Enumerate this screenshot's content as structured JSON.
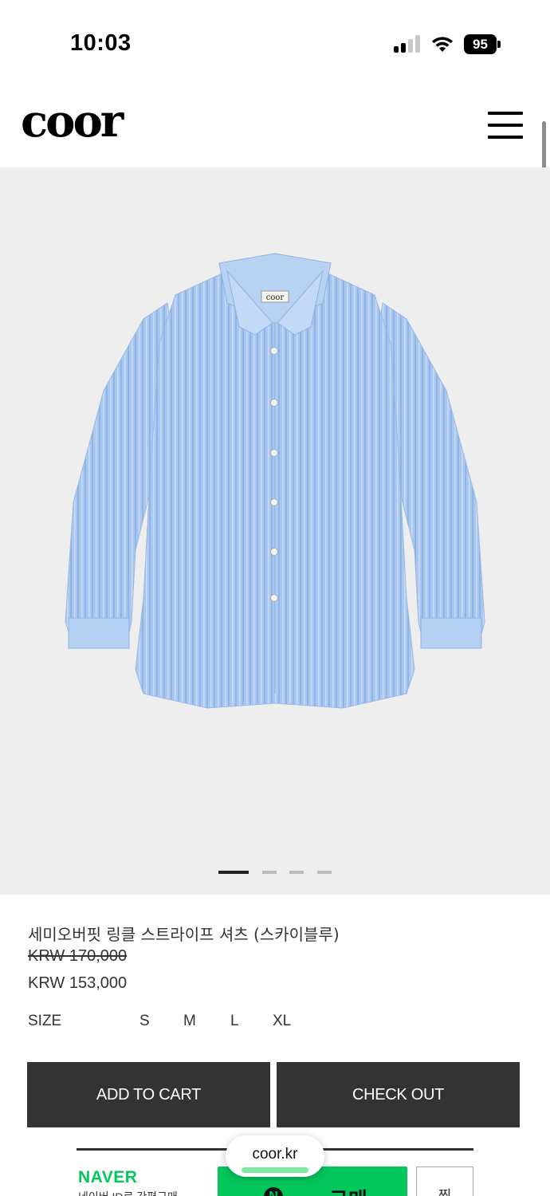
{
  "status_bar": {
    "time": "10:03",
    "battery": "95",
    "icons": [
      "signal-icon",
      "wifi-icon",
      "battery-icon"
    ]
  },
  "header": {
    "logo": "coor",
    "menu_icon": "hamburger-menu-icon"
  },
  "gallery": {
    "image_alt": "sky blue striped shirt",
    "label_tag": "coor",
    "pager_count": 4,
    "pager_active_index": 0,
    "background": "#eeeeee"
  },
  "product": {
    "name": "세미오버핏 링클 스트라이프 셔츠 (스카이블루)",
    "price_original": "KRW 170,000",
    "price_sale": "KRW 153,000",
    "size_label": "SIZE",
    "sizes": [
      "S",
      "M",
      "L",
      "XL"
    ]
  },
  "actions": {
    "add_to_cart": "ADD TO CART",
    "check_out": "CHECK OUT"
  },
  "naver_pay": {
    "brand": "NAVER",
    "subtext": "네이버 ID로 간편구매",
    "button_icon_letter": "N",
    "button_label": "pay 구매",
    "wish_label": "찜",
    "accent": "#03c75a"
  },
  "browser": {
    "url": "coor.kr"
  },
  "colors": {
    "button_dark": "#333333",
    "text": "#333333"
  }
}
